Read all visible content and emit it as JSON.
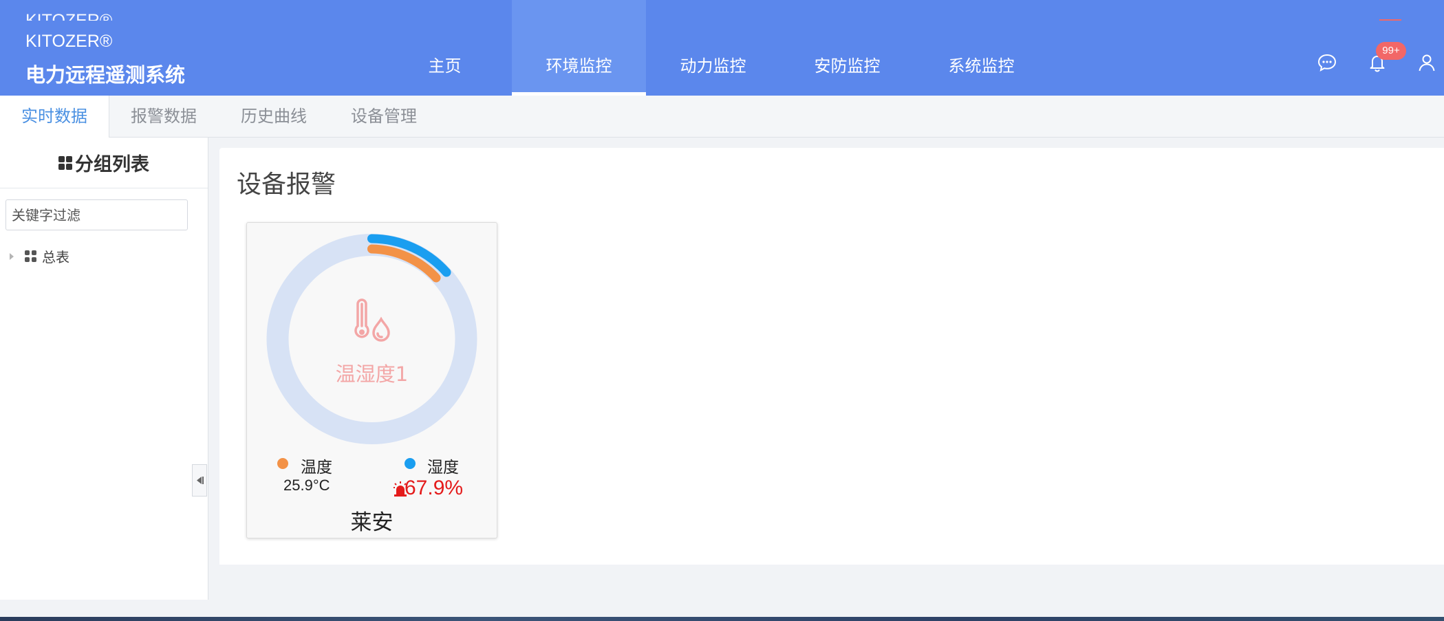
{
  "header": {
    "brand_ghost": "KITOZER®",
    "brand": "KITOZER®",
    "system_title": "电力远程遥测系统",
    "nav": [
      {
        "label": "主页",
        "active": false
      },
      {
        "label": "环境监控",
        "active": true
      },
      {
        "label": "动力监控",
        "active": false
      },
      {
        "label": "安防监控",
        "active": false
      },
      {
        "label": "系统监控",
        "active": false
      }
    ],
    "notification_badge": "99+",
    "icons": [
      "chat-icon",
      "bell-icon",
      "user-icon"
    ],
    "bg_color": "#5b87ec"
  },
  "subtabs": [
    {
      "label": "实时数据",
      "active": true
    },
    {
      "label": "报警数据",
      "active": false
    },
    {
      "label": "历史曲线",
      "active": false
    },
    {
      "label": "设备管理",
      "active": false
    }
  ],
  "sidebar": {
    "title": "分组列表",
    "filter_placeholder": "关键字过滤",
    "tree": [
      {
        "label": "总表",
        "expanded": false
      }
    ]
  },
  "main": {
    "section_title": "设备报警",
    "devices": [
      {
        "name": "温湿度1",
        "location": "莱安",
        "status": "alarm",
        "temperature": {
          "label": "温度",
          "value": "25.9°C",
          "color": "#f39247",
          "alarm": false
        },
        "humidity": {
          "label": "湿度",
          "value": "67.9%",
          "color": "#1a9ef0",
          "alarm": true
        },
        "alarm_color": "#e41b1b"
      }
    ]
  }
}
